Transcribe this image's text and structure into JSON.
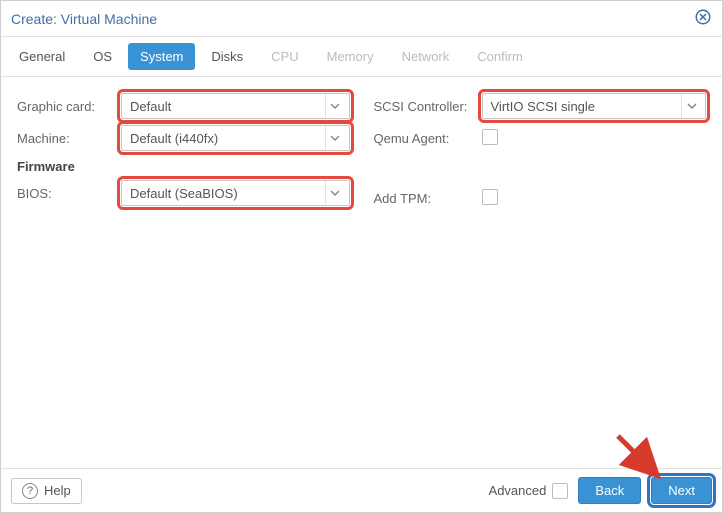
{
  "title": "Create: Virtual Machine",
  "tabs": {
    "general": "General",
    "os": "OS",
    "system": "System",
    "disks": "Disks",
    "cpu": "CPU",
    "memory": "Memory",
    "network": "Network",
    "confirm": "Confirm"
  },
  "labels": {
    "graphic_card": "Graphic card:",
    "machine": "Machine:",
    "firmware": "Firmware",
    "bios": "BIOS:",
    "scsi_controller": "SCSI Controller:",
    "qemu_agent": "Qemu Agent:",
    "add_tpm": "Add TPM:"
  },
  "values": {
    "graphic_card": "Default",
    "machine": "Default (i440fx)",
    "bios": "Default (SeaBIOS)",
    "scsi_controller": "VirtIO SCSI single"
  },
  "footer": {
    "help": "Help",
    "advanced": "Advanced",
    "back": "Back",
    "next": "Next"
  }
}
